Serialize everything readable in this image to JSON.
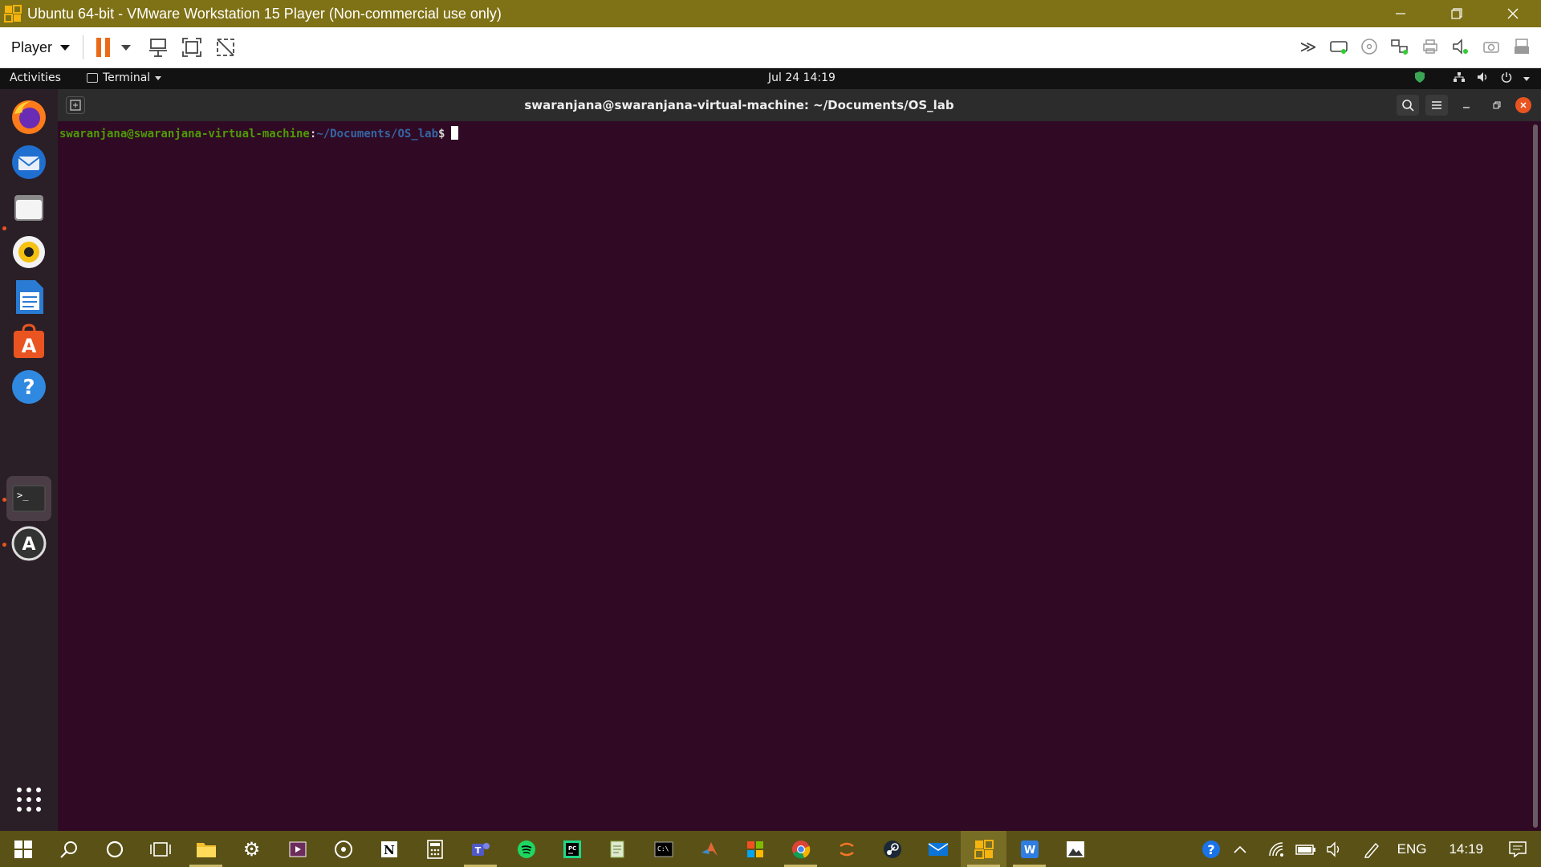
{
  "vmware": {
    "title": "Ubuntu 64-bit - VMware Workstation 15 Player (Non-commercial use only)",
    "player_menu_label": "Player",
    "window_controls": [
      "minimize-icon",
      "restore-icon",
      "close-icon"
    ],
    "toolbar_left_icons": [
      "pause-icon",
      "send-ctrl-alt-del-icon",
      "fullscreen-icon",
      "unity-icon"
    ],
    "toolbar_right_icons": [
      "more-icon",
      "hard-disk-icon",
      "cd-dvd-icon",
      "network-adapter-icon",
      "printer-icon",
      "sound-card-icon",
      "camera-icon",
      "usb-device-icon"
    ]
  },
  "gnome": {
    "activities": "Activities",
    "app_menu": "Terminal",
    "clock": "Jul 24  14:19",
    "tray_icons": [
      "shield-icon",
      "network-icon",
      "volume-icon",
      "power-icon",
      "chevron-down-icon"
    ]
  },
  "dock": {
    "items": [
      {
        "name": "firefox",
        "running": false
      },
      {
        "name": "thunderbird",
        "running": false
      },
      {
        "name": "files",
        "running": true
      },
      {
        "name": "rhythmbox",
        "running": false
      },
      {
        "name": "libreoffice-writer",
        "running": false
      },
      {
        "name": "ubuntu-software",
        "running": false
      },
      {
        "name": "help",
        "running": false
      },
      {
        "name": "terminal",
        "running": true
      },
      {
        "name": "software-updater",
        "running": true
      }
    ],
    "show_apps": "show-applications-icon"
  },
  "terminal": {
    "title": "swaranjana@swaranjana-virtual-machine: ~/Documents/OS_lab",
    "prompt_user_host": "swaranjana@swaranjana-virtual-machine",
    "prompt_colon": ":",
    "prompt_path": "~/Documents/OS_lab",
    "prompt_symbol": "$"
  },
  "taskbar": {
    "apps": [
      "start-icon",
      "search-icon",
      "cortana-icon",
      "task-view-icon",
      "file-explorer-icon",
      "settings-icon",
      "media-player-icon",
      "groove-icon",
      "notion-icon",
      "calculator-icon",
      "teams-icon",
      "spotify-icon",
      "pycharm-icon",
      "notepad-icon",
      "cmd-icon",
      "matlab-icon",
      "office-icon",
      "chrome-icon",
      "jupyter-icon",
      "steam-icon",
      "mail-icon",
      "vmware-icon",
      "wps-icon",
      "photos-icon"
    ],
    "active_app": "vmware-icon",
    "language": "ENG",
    "time": "14:19"
  },
  "colors": {
    "vm_titlebar": "#7f7115",
    "taskbar": "#5a5116",
    "terminal_bg": "#300a24",
    "prompt_user": "#4e9a06",
    "prompt_path": "#3465a4",
    "ubuntu_orange": "#e95420"
  }
}
